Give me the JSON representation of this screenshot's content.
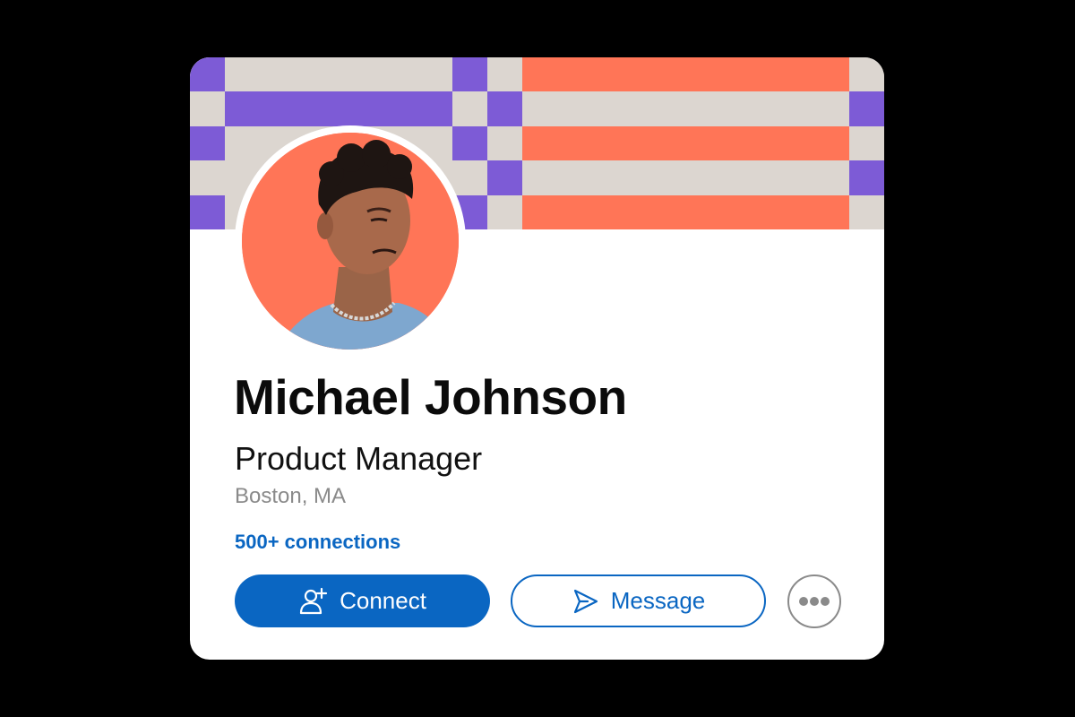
{
  "profile": {
    "name": "Michael Johnson",
    "title": "Product Manager",
    "location": "Boston, MA",
    "connections": "500+ connections"
  },
  "actions": {
    "connect_label": "Connect",
    "message_label": "Message",
    "connect_icon": "add-user-icon",
    "message_icon": "send-icon",
    "more_icon": "more-horizontal-icon"
  },
  "colors": {
    "page_background": "#000000",
    "card_background": "#ffffff",
    "banner_purple": "#7d5bd6",
    "banner_beige": "#dcd6d0",
    "banner_coral": "#ff7557",
    "accent_blue": "#0a66c2",
    "muted_gray": "#8a8a8a"
  }
}
